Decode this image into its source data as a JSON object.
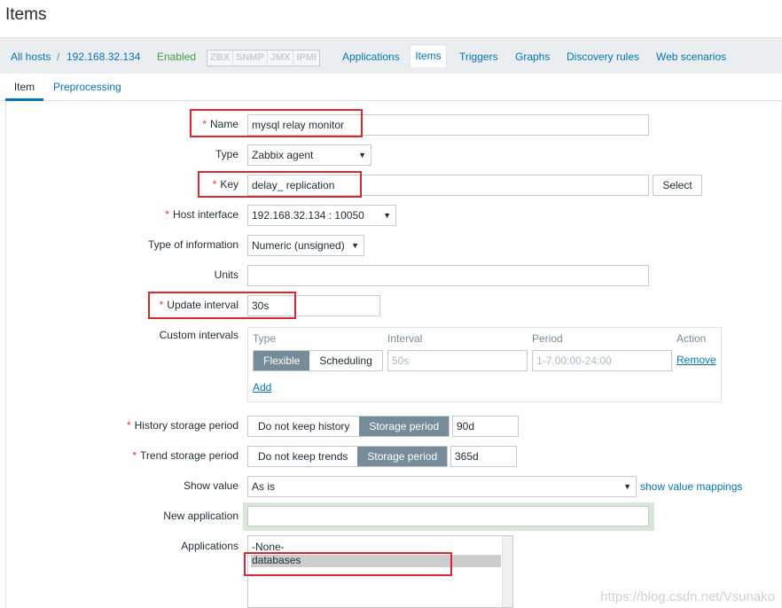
{
  "page": {
    "title": "Items"
  },
  "hostbar": {
    "all_hosts": "All hosts",
    "separator": "/",
    "host": "192.168.32.134",
    "status": "Enabled",
    "badges": [
      "ZBX",
      "SNMP",
      "JMX",
      "IPMI"
    ],
    "links": {
      "applications": "Applications",
      "items": "Items",
      "triggers": "Triggers",
      "graphs": "Graphs",
      "discovery": "Discovery rules",
      "web": "Web scenarios"
    }
  },
  "tabs": {
    "item": "Item",
    "preprocessing": "Preprocessing"
  },
  "form": {
    "name": {
      "label": "Name",
      "value": "mysql relay monitor"
    },
    "type": {
      "label": "Type",
      "value": "Zabbix agent"
    },
    "key": {
      "label": "Key",
      "value": "delay_ replication",
      "select": "Select"
    },
    "host_interface": {
      "label": "Host interface",
      "value": "192.168.32.134 : 10050"
    },
    "type_info": {
      "label": "Type of information",
      "value": "Numeric (unsigned)"
    },
    "units": {
      "label": "Units",
      "value": ""
    },
    "update_interval": {
      "label": "Update interval",
      "value": "30s"
    },
    "custom_intervals": {
      "label": "Custom intervals",
      "headers": {
        "type": "Type",
        "interval": "Interval",
        "period": "Period",
        "action": "Action"
      },
      "flexible": "Flexible",
      "scheduling": "Scheduling",
      "interval_placeholder": "50s",
      "period_placeholder": "1-7,00:00-24:00",
      "remove": "Remove",
      "add": "Add"
    },
    "history": {
      "label": "History storage period",
      "no_keep": "Do not keep history",
      "storage": "Storage period",
      "value": "90d"
    },
    "trend": {
      "label": "Trend storage period",
      "no_keep": "Do not keep trends",
      "storage": "Storage period",
      "value": "365d"
    },
    "show_value": {
      "label": "Show value",
      "value": "As is",
      "mappings": "show value mappings"
    },
    "new_application": {
      "label": "New application",
      "value": ""
    },
    "applications": {
      "label": "Applications",
      "options": [
        "-None-",
        "databases"
      ]
    }
  },
  "watermark": "https://blog.csdn.net/Vsunako",
  "colors": {
    "link": "#0275b8",
    "required": "#e33734",
    "highlight": "#e0262d",
    "enabled": "#429e47"
  }
}
